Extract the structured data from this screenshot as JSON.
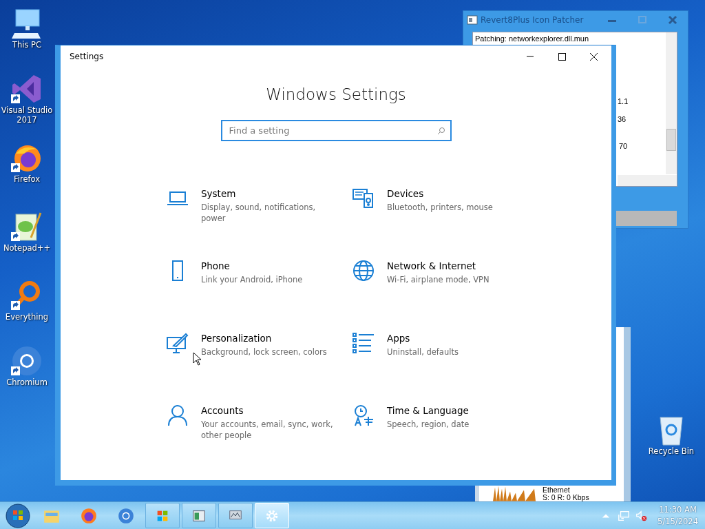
{
  "desktop_icons": [
    {
      "label": "This PC"
    },
    {
      "label": "Visual Studio 2017",
      "shortcut": true
    },
    {
      "label": "Firefox",
      "shortcut": true
    },
    {
      "label": "Notepad++",
      "shortcut": true
    },
    {
      "label": "Everything",
      "shortcut": true
    },
    {
      "label": "Chromium",
      "shortcut": true
    }
  ],
  "recycle_bin": {
    "label": "Recycle Bin"
  },
  "patcher_window": {
    "title": "Revert8Plus Icon Patcher",
    "log_lines": [
      "Patching: networkexplorer.dll.mun",
      "1.1",
      "36",
      "70"
    ],
    "progress": {
      "level": 1
    }
  },
  "background_window": {
    "name": "Ethernet",
    "reading": "S: 0 R: 0 Kbps"
  },
  "settings_window": {
    "title": "Settings",
    "heading": "Windows Settings",
    "search": {
      "placeholder": "Find a setting"
    },
    "categories": [
      {
        "name": "System",
        "description": "Display, sound, notifications, power"
      },
      {
        "name": "Devices",
        "description": "Bluetooth, printers, mouse"
      },
      {
        "name": "Phone",
        "description": "Link your Android, iPhone"
      },
      {
        "name": "Network & Internet",
        "description": "Wi-Fi, airplane mode, VPN"
      },
      {
        "name": "Personalization",
        "description": "Background, lock screen, colors"
      },
      {
        "name": "Apps",
        "description": "Uninstall, defaults"
      },
      {
        "name": "Accounts",
        "description": "Your accounts, email, sync, work, other people"
      },
      {
        "name": "Time & Language",
        "description": "Speech, region, date"
      }
    ]
  },
  "taskbar": {
    "window_buttons": [
      {
        "selected": false
      },
      {
        "selected": false
      },
      {
        "selected": false
      },
      {
        "selected": true
      }
    ],
    "clock": {
      "time": "11:30 AM",
      "date": "5/15/2024"
    }
  }
}
